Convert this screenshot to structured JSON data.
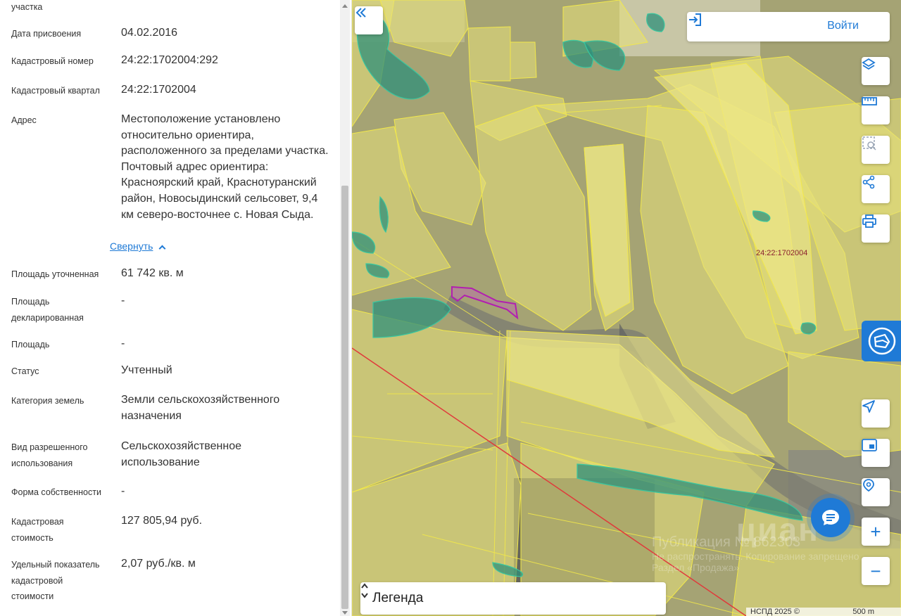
{
  "panel": {
    "top_partial": "участка",
    "fields": [
      {
        "label": "Дата присвоения",
        "value": "04.02.2016"
      },
      {
        "label": "Кадастровый номер",
        "value": "24:22:1702004:292"
      },
      {
        "label": "Кадастровый квартал",
        "value": "24:22:1702004"
      },
      {
        "label": "Адрес",
        "value": "Местоположение установлено относительно ориентира, расположенного за пределами участка. Почтовый адрес ориентира: Красноярский край, Краснотуранский район, Новосыдинский сельсовет, 9,4 км северо-восточнее с. Новая Сыда."
      },
      {
        "label": "Площадь уточненная",
        "value": "61 742 кв. м"
      },
      {
        "label": "Площадь декларированная",
        "value": "-"
      },
      {
        "label": "Площадь",
        "value": "-"
      },
      {
        "label": "Статус",
        "value": "Учтенный"
      },
      {
        "label": "Категория земель",
        "value": "Земли сельскохозяйственного назначения"
      },
      {
        "label": "Вид разрешенного использования",
        "value": "Сельскохозяйственное использование"
      },
      {
        "label": "Форма собственности",
        "value": "-"
      },
      {
        "label": "Кадастровая стоимость",
        "value": "127 805,94 руб."
      },
      {
        "label": "Удельный показатель кадастровой стоимости",
        "value": "2,07 руб./кв. м"
      }
    ],
    "collapse_label": "Свернуть"
  },
  "map": {
    "login_label": "Войти",
    "legend_label": "Легенда",
    "cadastral_quarter_label": "24:22:1702004",
    "zoom_in": "+",
    "zoom_out": "−",
    "attribution": "НСПД 2025 ©",
    "scale": "500 m",
    "watermark": {
      "brand": "циан",
      "line1": "Публикация № 862303",
      "line2": "Не распространять. Копирование запрещено",
      "line3": "Раздел «Продажа»"
    },
    "colors": {
      "accent": "#1f7ad6",
      "parcel_fill": "#e8e27a",
      "parcel_stroke": "#f2e84a",
      "water_fill": "#2f8f7a",
      "selected_parcel": "#b21fb0",
      "boundary_line": "#e0393b"
    }
  }
}
